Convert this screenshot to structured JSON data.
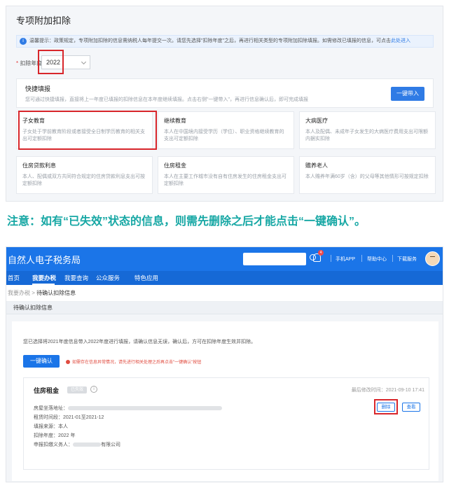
{
  "top": {
    "title": "专项附加扣除",
    "notice_text": "温馨提示：政策规定，专项附加扣除的信息需纳税人每年提交一次。请您先选择\"扣除年度\"之后，再进行相关类型的专项附加扣除填报。如需修改已填报的信息，可点击",
    "notice_link": "此处进入",
    "year_label": "扣除年度",
    "year_required_mark": "*",
    "year_value": "2022",
    "quick_title": "快捷填报",
    "quick_desc": "您可通过快捷填报，直接将上一年度已填报的扣除信息在本年度继续填报。点击右侧\"一键带入\"，再进行信息确认后，即可完成填报",
    "quick_button": "一键带入",
    "cards": [
      {
        "title": "子女教育",
        "desc": "子女处于学前教育阶段或者接受全日制学历教育的相关支出可定额扣除"
      },
      {
        "title": "继续教育",
        "desc": "本人在中国境内接受学历（学位）、职业资格继续教育的支出可定额扣除"
      },
      {
        "title": "大病医疗",
        "desc": "本人及配偶、未成年子女发生的大病医疗费用支出可限额内据实扣除"
      },
      {
        "title": "住房贷款利息",
        "desc": "本人、配偶或双方共同符合规定的住房贷款利息支出可按定额扣除"
      },
      {
        "title": "住房租金",
        "desc": "本人在主要工作城市没有自有住房发生的住房租金支出可定额扣除"
      },
      {
        "title": "赡养老人",
        "desc": "本人赡养年满60岁（含）的父母等其他情形可按规定扣除"
      }
    ]
  },
  "notice": "注意：如有“已失效”状态的信息，则需先删除之后才能点击“一键确认”。",
  "bottom": {
    "brand": "自然人电子税务局",
    "badge_count": "4",
    "topbar_links": [
      "手机APP",
      "帮助中心",
      "下载服务"
    ],
    "nav": [
      "首页",
      "我要办税",
      "我要查询",
      "公众服务",
      "特色应用"
    ],
    "crumb_parent": "我要办税",
    "crumb_sep": ">",
    "crumb_current": "待确认扣除信息",
    "page_title": "待确认扣除信息",
    "desc": "您已选择将2021年度信息带入2022年度进行填报，请确认信息无误，确认后，方可在扣除年度生效并扣除。",
    "confirm_button": "一键确认",
    "warn_text": "如需存在信息异常情况，请先进行相关处理之后再点击\"一键确认\"按钮",
    "record": {
      "title": "住房租金",
      "status": "已失效",
      "info_icon_text": "i",
      "modified_label": "最后修改时间：",
      "modified_value": "2021-09-10 17:41",
      "addr_label": "房屋坐落地址：",
      "period_label": "租赁时间段：",
      "period_value": "2021-01至2021-12",
      "source_label": "填报来源：",
      "source_value": "本人",
      "year_label": "扣除年度：",
      "year_value": "2022 年",
      "agent_label": "申报扣缴义务人：",
      "agent_value": "有限公司",
      "delete_button": "删除",
      "view_button": "查看"
    }
  }
}
